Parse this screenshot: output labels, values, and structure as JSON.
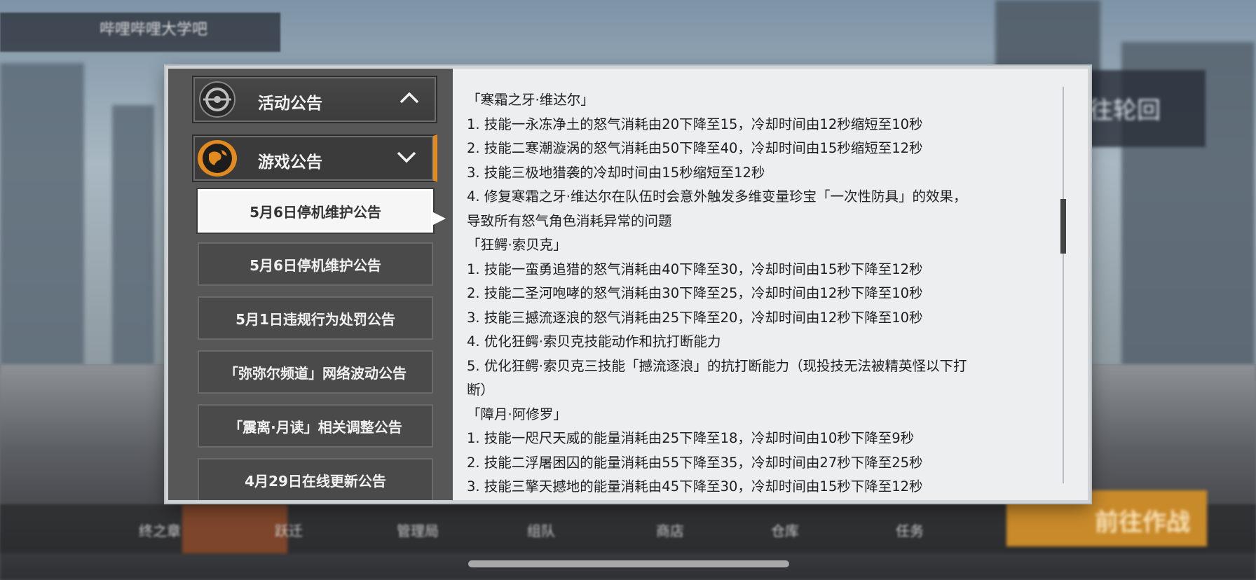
{
  "background": {
    "top_title": "哔哩哔哩大学吧",
    "right_panel_text": "前往轮回",
    "action_button": "前往作战",
    "bottom_nav": [
      "终之章",
      "跃迁",
      "管理局",
      "组队",
      "商店",
      "仓库",
      "任务"
    ]
  },
  "sidebar": {
    "categories": [
      {
        "label": "活动公告",
        "icon": "activity-emblem-icon",
        "expanded": false
      },
      {
        "label": "游戏公告",
        "icon": "globe-emblem-icon",
        "expanded": true
      }
    ],
    "notices": [
      "5月6日停机维护公告",
      "5月6日停机维护公告",
      "5月1日违规行为处罚公告",
      "「弥弥尔频道」网络波动公告",
      "「震离·月读」相关调整公告",
      "4月29日在线更新公告"
    ],
    "selected_index": 0
  },
  "content": {
    "lines": [
      "「寒霜之牙·维达尔」",
      "1. 技能一永冻净土的怒气消耗由20下降至15，冷却时间由12秒缩短至10秒",
      "2. 技能二寒潮漩涡的怒气消耗由50下降至40，冷却时间由15秒缩短至12秒",
      "3. 技能三极地猎袭的冷却时间由15秒缩短至12秒",
      "4. 修复寒霜之牙·维达尔在队伍时会意外触发多维变量珍宝「一次性防具」的效果，",
      "导致所有怒气角色消耗异常的问题",
      "「狂鳄·索贝克」",
      "1. 技能一蛮勇追猎的怒气消耗由40下降至30，冷却时间由15秒下降至12秒",
      "2. 技能二圣河咆哮的怒气消耗由30下降至25，冷却时间由12秒下降至10秒",
      "3. 技能三撼流逐浪的怒气消耗由25下降至20，冷却时间由12秒下降至10秒",
      "4. 优化狂鳄·索贝克技能动作和抗打断能力",
      "5. 优化狂鳄·索贝克三技能「撼流逐浪」的抗打断能力（现投技无法被精英怪以下打",
      "断）",
      "「障月·阿修罗」",
      "1. 技能一咫尺天威的能量消耗由25下降至18，冷却时间由10秒下降至9秒",
      "2. 技能二浮屠困囚的能量消耗由55下降至35，冷却时间由27秒下降至25秒",
      "3. 技能三擎天撼地的能量消耗由45下降至30，冷却时间由15秒下降至12秒"
    ]
  },
  "colors": {
    "accent": "#e28a1f",
    "panel_dark": "#575757",
    "content_bg": "#eceef0"
  }
}
